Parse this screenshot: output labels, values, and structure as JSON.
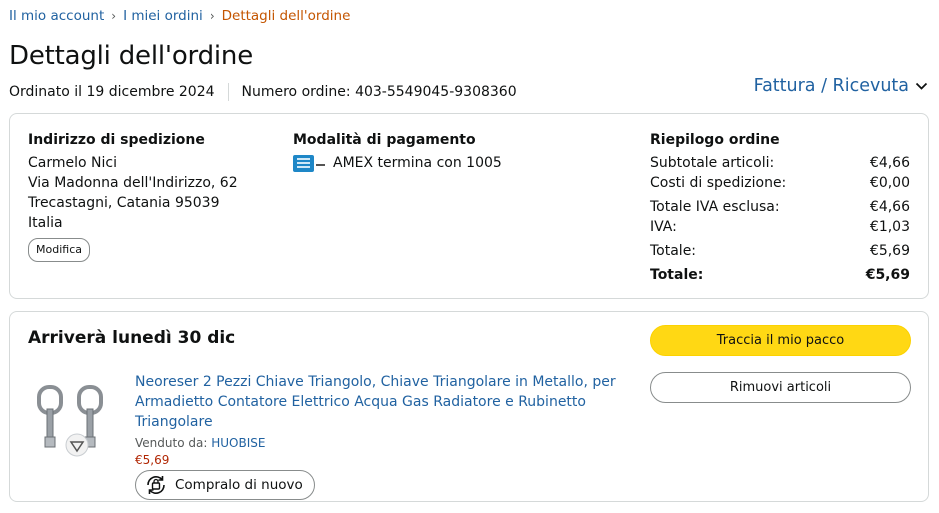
{
  "breadcrumb": {
    "account": "Il mio account",
    "orders": "I miei ordini",
    "current": "Dettagli dell'ordine",
    "separator": "›"
  },
  "page": {
    "title": "Dettagli dell'ordine",
    "ordered_on": "Ordinato il 19 dicembre 2024",
    "order_number": "Numero ordine: 403-5549045-9308360",
    "invoice_link": "Fattura / Ricevuta"
  },
  "shipping": {
    "heading": "Indirizzo di spedizione",
    "name": "Carmelo Nici",
    "street": "Via Madonna dell'Indirizzo, 62",
    "city": "Trecastagni, Catania 95039",
    "country": "Italia",
    "modify_label": "Modifica"
  },
  "payment": {
    "heading": "Modalità di pagamento",
    "card_text": "AMEX termina con 1005"
  },
  "summary": {
    "heading": "Riepilogo ordine",
    "rows": [
      {
        "label": "Subtotale articoli:",
        "value": "€4,66"
      },
      {
        "label": "Costi di spedizione:",
        "value": "€0,00"
      },
      {
        "label": "Totale IVA esclusa:",
        "value": "€4,66"
      },
      {
        "label": "IVA:",
        "value": "€1,03"
      },
      {
        "label": "Totale:",
        "value": "€5,69"
      },
      {
        "label": "Totale:",
        "value": "€5,69"
      }
    ]
  },
  "shipment": {
    "arrival": "Arriverà lunedì 30 dic",
    "track_label": "Traccia il mio pacco",
    "remove_label": "Rimuovi articoli",
    "product_title": "Neoreser 2 Pezzi Chiave Triangolo, Chiave Triangolare in Metallo, per Armadietto Contatore Elettrico Acqua Gas Radiatore e Rubinetto Triangolare",
    "sold_by_label": "Venduto da:",
    "seller": "HUOBISE",
    "price": "€5,69",
    "rebuy_label": "Compralo di nuovo"
  },
  "colors": {
    "link": "#2162a1",
    "breadcrumb_current": "#c45500",
    "track_button": "#ffd814",
    "price": "#b12704",
    "amex": "#1e87c7"
  },
  "icons": {
    "invoice_chevron": "chevron-down-icon",
    "payment_card": "amex-card-icon",
    "rebuy": "rebuy-icon"
  }
}
